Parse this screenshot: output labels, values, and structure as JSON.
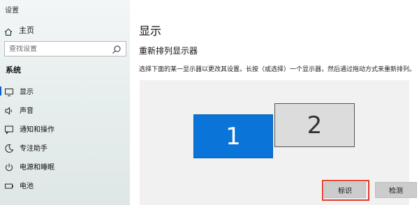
{
  "app": {
    "title": "设置"
  },
  "sidebar": {
    "home": {
      "label": "主页",
      "icon": "home-icon"
    },
    "search": {
      "placeholder": "查找设置",
      "icon": "search-icon"
    },
    "section": "系统",
    "items": [
      {
        "label": "显示",
        "icon": "monitor-icon",
        "active": true
      },
      {
        "label": "声音",
        "icon": "speaker-icon"
      },
      {
        "label": "通知和操作",
        "icon": "notification-icon"
      },
      {
        "label": "专注助手",
        "icon": "moon-icon"
      },
      {
        "label": "电源和睡眠",
        "icon": "power-icon"
      },
      {
        "label": "电池",
        "icon": "battery-icon"
      }
    ]
  },
  "main": {
    "title": "显示",
    "subtitle": "重新排列显示器",
    "description": "选择下面的某一显示器以更改其设置。长按（或选择）一个显示器，然后通过拖动方式来重新排列。",
    "monitors": [
      {
        "label": "1",
        "selected": true
      },
      {
        "label": "2",
        "selected": false
      }
    ],
    "buttons": {
      "identify": "标识",
      "detect": "检测"
    }
  },
  "colors": {
    "accent": "#0a74d8",
    "highlight": "#e23b2e"
  }
}
